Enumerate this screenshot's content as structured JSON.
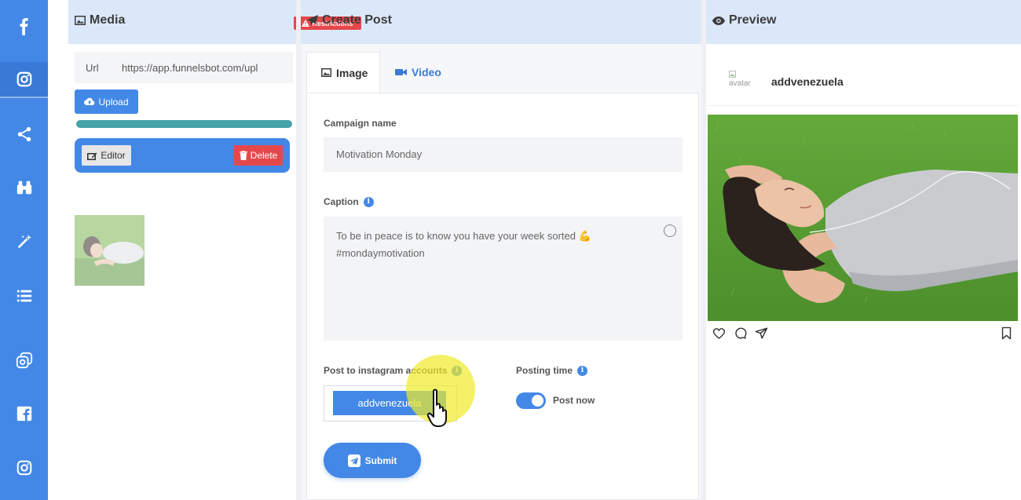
{
  "rail": {
    "items": [
      {
        "icon": "facebook-f-icon"
      },
      {
        "icon": "instagram-icon",
        "active": true
      },
      {
        "icon": "share-icon"
      },
      {
        "icon": "binoculars-icon"
      },
      {
        "icon": "magic-wand-icon"
      },
      {
        "icon": "list-icon"
      },
      {
        "icon": "multiple-instagram-icon"
      },
      {
        "icon": "facebook-square-icon"
      },
      {
        "icon": "instagram-outline-icon"
      }
    ]
  },
  "header": {
    "media_title": "Media",
    "restrictions_label": "Restrictions",
    "create_title": "Create Post",
    "preview_title": "Preview"
  },
  "media": {
    "url_label": "Url",
    "url_value": "https://app.funnelsbot.com/upl",
    "upload_label": "Upload",
    "progress": 1.0,
    "editor_label": "Editor",
    "delete_label": "Delete"
  },
  "post": {
    "tabs": [
      {
        "label": "Image",
        "active": true
      },
      {
        "label": "Video",
        "active": false
      }
    ],
    "campaign_label": "Campaign name",
    "campaign_value": "Motivation Monday",
    "caption_label": "Caption",
    "caption_line1": "To be in peace is to know you have your week sorted 💪",
    "caption_line2": "#mondaymotivation",
    "accounts_label": "Post to instagram accounts",
    "account_chip": "addvenezuela",
    "posting_time_label": "Posting time",
    "post_now_label": "Post now",
    "post_now_on": true,
    "submit_label": "Submit"
  },
  "preview": {
    "avatar_alt": "avatar",
    "username": "addvenezuela"
  },
  "colors": {
    "accent": "#4388e6",
    "header_bg": "#dbe8fa",
    "danger": "#e5484a",
    "progress": "#46a3a8"
  }
}
